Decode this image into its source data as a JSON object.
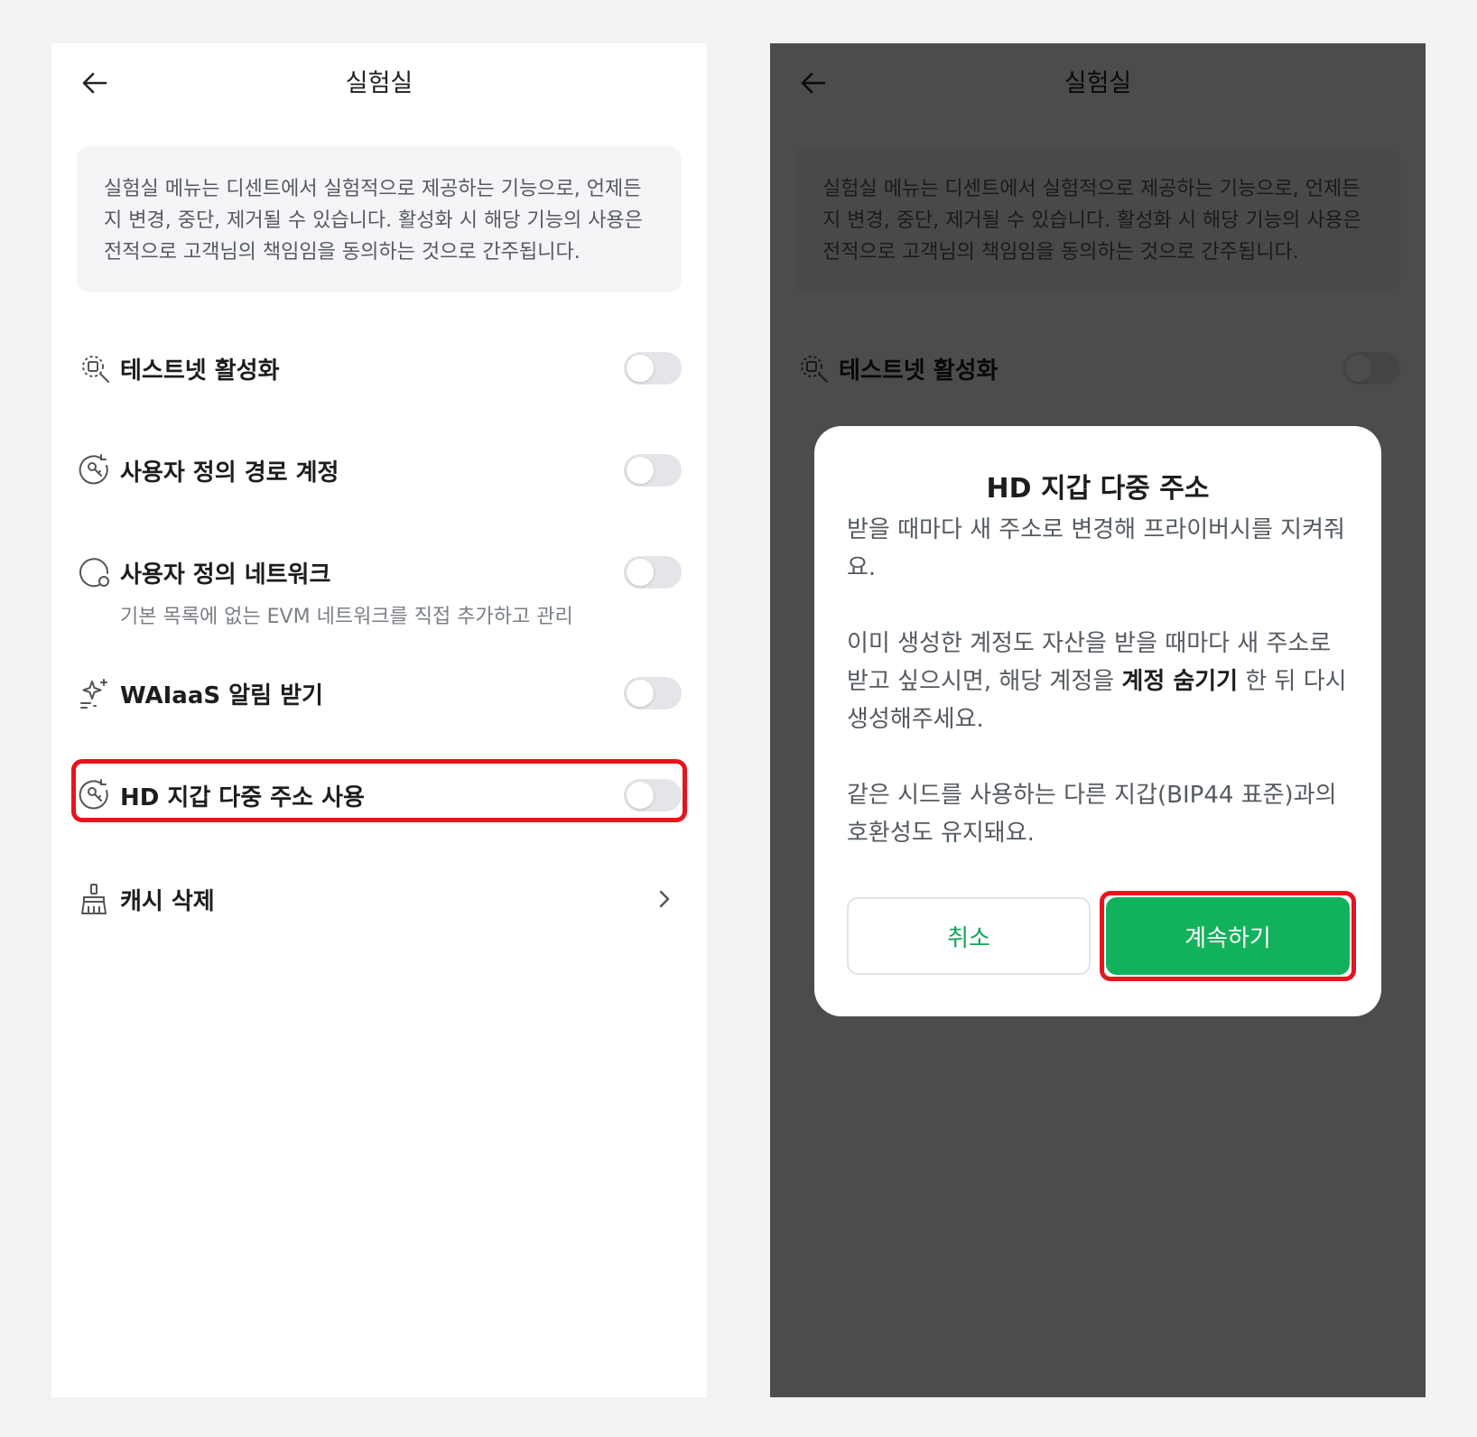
{
  "header": {
    "title": "실험실",
    "back_icon": "arrow-left-icon"
  },
  "notice": {
    "text": "실험실 메뉴는 디센트에서 실험적으로 제공하는 기능으로, 언제든지 변경, 중단, 제거될 수 있습니다. 활성화 시 해당 기능의 사용은 전적으로 고객님의 책임임을 동의하는 것으로 간주됩니다."
  },
  "settings": [
    {
      "label": "테스트넷 활성화",
      "icon": "testnet-search-icon",
      "enabled": false
    },
    {
      "label": "사용자 정의 경로 계정",
      "icon": "custom-path-icon",
      "enabled": false
    },
    {
      "label": "사용자 정의 네트워크",
      "subtitle": "기본 목록에 없는 EVM 네트워크를 직접 추가하고 관리",
      "icon": "custom-network-icon",
      "enabled": false
    },
    {
      "label": "WAIaaS 알림 받기",
      "icon": "sparkle-icon",
      "enabled": false
    },
    {
      "label": "HD 지갑 다중 주소 사용",
      "icon": "hd-wallet-icon",
      "enabled": false
    }
  ],
  "cache": {
    "label": "캐시 삭제",
    "icon": "broom-icon",
    "chevron_icon": "chevron-right-icon"
  },
  "modal": {
    "title": "HD 지갑 다중 주소",
    "paragraph1": "받을 때마다 새 주소로 변경해 프라이버시를 지켜줘요.",
    "paragraph2_prefix": "이미 생성한 계정도 자산을 받을 때마다 새 주소로 받고 싶으시면, 해당 계정을 ",
    "paragraph2_bold": "계정 숨기기",
    "paragraph2_suffix": " 한 뒤 다시 생성해주세요.",
    "paragraph3": "같은 시드를 사용하는 다른 지갑(BIP44 표준)과의 호환성도 유지돼요.",
    "cancel_label": "취소",
    "continue_label": "계속하기"
  },
  "colors": {
    "accent_green": "#12b25c",
    "highlight_red": "#e8131b",
    "dim_overlay": "#4d4d4d"
  }
}
